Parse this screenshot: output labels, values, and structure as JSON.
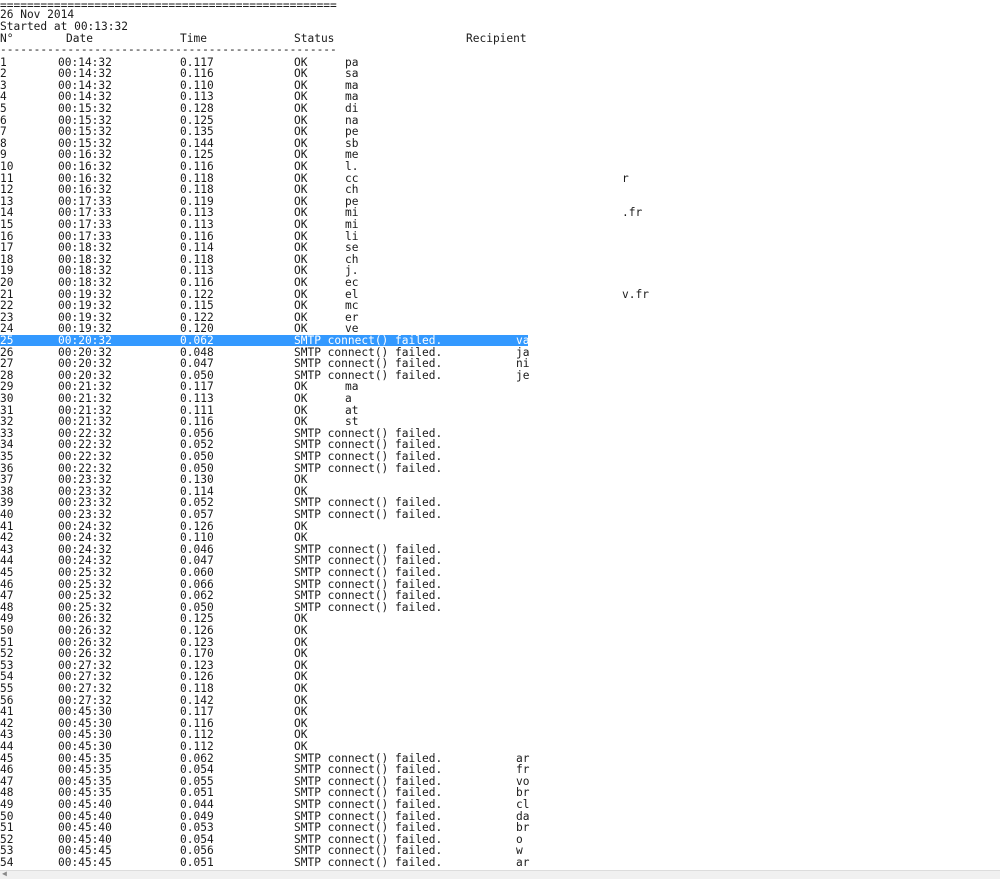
{
  "header": {
    "separator_top": "==================================================",
    "date_line": "26 Nov 2014",
    "started_line": "Started at 00:13:32",
    "separator_mid": "--------------------------------------------------"
  },
  "columns": {
    "num": "N°",
    "date": "Date",
    "time": "Time",
    "status": "Status",
    "recipient": "Recipient"
  },
  "rows": [
    {
      "n": "1",
      "d": "00:14:32",
      "t": "0.117",
      "s": "OK",
      "r": "pa"
    },
    {
      "n": "2",
      "d": "00:14:32",
      "t": "0.116",
      "s": "OK",
      "r": "sa"
    },
    {
      "n": "3",
      "d": "00:14:32",
      "t": "0.110",
      "s": "OK",
      "r": "ma"
    },
    {
      "n": "4",
      "d": "00:14:32",
      "t": "0.113",
      "s": "OK",
      "r": "ma"
    },
    {
      "n": "5",
      "d": "00:15:32",
      "t": "0.128",
      "s": "OK",
      "r": "di"
    },
    {
      "n": "6",
      "d": "00:15:32",
      "t": "0.125",
      "s": "OK",
      "r": "na"
    },
    {
      "n": "7",
      "d": "00:15:32",
      "t": "0.135",
      "s": "OK",
      "r": "pe"
    },
    {
      "n": "8",
      "d": "00:15:32",
      "t": "0.144",
      "s": "OK",
      "r": "sb"
    },
    {
      "n": "9",
      "d": "00:16:32",
      "t": "0.125",
      "s": "OK",
      "r": "me"
    },
    {
      "n": "10",
      "d": "00:16:32",
      "t": "0.116",
      "s": "OK",
      "r": "l."
    },
    {
      "n": "11",
      "d": "00:16:32",
      "t": "0.118",
      "s": "OK",
      "r": "cc"
    },
    {
      "n": "12",
      "d": "00:16:32",
      "t": "0.118",
      "s": "OK",
      "r": "ch"
    },
    {
      "n": "13",
      "d": "00:17:33",
      "t": "0.119",
      "s": "OK",
      "r": "pe"
    },
    {
      "n": "14",
      "d": "00:17:33",
      "t": "0.113",
      "s": "OK",
      "r": "mi"
    },
    {
      "n": "15",
      "d": "00:17:33",
      "t": "0.113",
      "s": "OK",
      "r": "mi"
    },
    {
      "n": "16",
      "d": "00:17:33",
      "t": "0.116",
      "s": "OK",
      "r": "li"
    },
    {
      "n": "17",
      "d": "00:18:32",
      "t": "0.114",
      "s": "OK",
      "r": "se"
    },
    {
      "n": "18",
      "d": "00:18:32",
      "t": "0.118",
      "s": "OK",
      "r": "ch"
    },
    {
      "n": "19",
      "d": "00:18:32",
      "t": "0.113",
      "s": "OK",
      "r": "j."
    },
    {
      "n": "20",
      "d": "00:18:32",
      "t": "0.116",
      "s": "OK",
      "r": "ec"
    },
    {
      "n": "21",
      "d": "00:19:32",
      "t": "0.122",
      "s": "OK",
      "r": "el"
    },
    {
      "n": "22",
      "d": "00:19:32",
      "t": "0.115",
      "s": "OK",
      "r": "mc"
    },
    {
      "n": "23",
      "d": "00:19:32",
      "t": "0.122",
      "s": "OK",
      "r": "er"
    },
    {
      "n": "24",
      "d": "00:19:32",
      "t": "0.120",
      "s": "OK",
      "r": "ve"
    },
    {
      "n": "25",
      "d": "00:20:32",
      "t": "0.062",
      "s": "SMTP connect() failed.",
      "r": "va",
      "selected": true
    },
    {
      "n": "26",
      "d": "00:20:32",
      "t": "0.048",
      "s": "SMTP connect() failed.",
      "r": "ja"
    },
    {
      "n": "27",
      "d": "00:20:32",
      "t": "0.047",
      "s": "SMTP connect() failed.",
      "r": "ni"
    },
    {
      "n": "28",
      "d": "00:20:32",
      "t": "0.050",
      "s": "SMTP connect() failed.",
      "r": "je"
    },
    {
      "n": "29",
      "d": "00:21:32",
      "t": "0.117",
      "s": "OK",
      "r": "ma"
    },
    {
      "n": "30",
      "d": "00:21:32",
      "t": "0.113",
      "s": "OK",
      "r": "a"
    },
    {
      "n": "31",
      "d": "00:21:32",
      "t": "0.111",
      "s": "OK",
      "r": "at"
    },
    {
      "n": "32",
      "d": "00:21:32",
      "t": "0.116",
      "s": "OK",
      "r": "st"
    },
    {
      "n": "33",
      "d": "00:22:32",
      "t": "0.056",
      "s": "SMTP connect() failed.",
      "r": ""
    },
    {
      "n": "34",
      "d": "00:22:32",
      "t": "0.052",
      "s": "SMTP connect() failed.",
      "r": ""
    },
    {
      "n": "35",
      "d": "00:22:32",
      "t": "0.050",
      "s": "SMTP connect() failed.",
      "r": ""
    },
    {
      "n": "36",
      "d": "00:22:32",
      "t": "0.050",
      "s": "SMTP connect() failed.",
      "r": ""
    },
    {
      "n": "37",
      "d": "00:23:32",
      "t": "0.130",
      "s": "OK",
      "r": ""
    },
    {
      "n": "38",
      "d": "00:23:32",
      "t": "0.114",
      "s": "OK",
      "r": ""
    },
    {
      "n": "39",
      "d": "00:23:32",
      "t": "0.052",
      "s": "SMTP connect() failed.",
      "r": ""
    },
    {
      "n": "40",
      "d": "00:23:32",
      "t": "0.057",
      "s": "SMTP connect() failed.",
      "r": ""
    },
    {
      "n": "41",
      "d": "00:24:32",
      "t": "0.126",
      "s": "OK",
      "r": ""
    },
    {
      "n": "42",
      "d": "00:24:32",
      "t": "0.110",
      "s": "OK",
      "r": ""
    },
    {
      "n": "43",
      "d": "00:24:32",
      "t": "0.046",
      "s": "SMTP connect() failed.",
      "r": ""
    },
    {
      "n": "44",
      "d": "00:24:32",
      "t": "0.047",
      "s": "SMTP connect() failed.",
      "r": ""
    },
    {
      "n": "45",
      "d": "00:25:32",
      "t": "0.060",
      "s": "SMTP connect() failed.",
      "r": ""
    },
    {
      "n": "46",
      "d": "00:25:32",
      "t": "0.066",
      "s": "SMTP connect() failed.",
      "r": ""
    },
    {
      "n": "47",
      "d": "00:25:32",
      "t": "0.062",
      "s": "SMTP connect() failed.",
      "r": ""
    },
    {
      "n": "48",
      "d": "00:25:32",
      "t": "0.050",
      "s": "SMTP connect() failed.",
      "r": ""
    },
    {
      "n": "49",
      "d": "00:26:32",
      "t": "0.125",
      "s": "OK",
      "r": ""
    },
    {
      "n": "50",
      "d": "00:26:32",
      "t": "0.126",
      "s": "OK",
      "r": ""
    },
    {
      "n": "51",
      "d": "00:26:32",
      "t": "0.123",
      "s": "OK",
      "r": ""
    },
    {
      "n": "52",
      "d": "00:26:32",
      "t": "0.170",
      "s": "OK",
      "r": ""
    },
    {
      "n": "53",
      "d": "00:27:32",
      "t": "0.123",
      "s": "OK",
      "r": ""
    },
    {
      "n": "54",
      "d": "00:27:32",
      "t": "0.126",
      "s": "OK",
      "r": ""
    },
    {
      "n": "55",
      "d": "00:27:32",
      "t": "0.118",
      "s": "OK",
      "r": ""
    },
    {
      "n": "56",
      "d": "00:27:32",
      "t": "0.142",
      "s": "OK",
      "r": ""
    },
    {
      "n": "41",
      "d": "00:45:30",
      "t": "0.117",
      "s": "OK",
      "r": ""
    },
    {
      "n": "42",
      "d": "00:45:30",
      "t": "0.116",
      "s": "OK",
      "r": ""
    },
    {
      "n": "43",
      "d": "00:45:30",
      "t": "0.112",
      "s": "OK",
      "r": ""
    },
    {
      "n": "44",
      "d": "00:45:30",
      "t": "0.112",
      "s": "OK",
      "r": ""
    },
    {
      "n": "45",
      "d": "00:45:35",
      "t": "0.062",
      "s": "SMTP connect() failed.",
      "r": "ar"
    },
    {
      "n": "46",
      "d": "00:45:35",
      "t": "0.054",
      "s": "SMTP connect() failed.",
      "r": "fr"
    },
    {
      "n": "47",
      "d": "00:45:35",
      "t": "0.055",
      "s": "SMTP connect() failed.",
      "r": "vo"
    },
    {
      "n": "48",
      "d": "00:45:35",
      "t": "0.051",
      "s": "SMTP connect() failed.",
      "r": "br"
    },
    {
      "n": "49",
      "d": "00:45:40",
      "t": "0.044",
      "s": "SMTP connect() failed.",
      "r": "cl"
    },
    {
      "n": "50",
      "d": "00:45:40",
      "t": "0.049",
      "s": "SMTP connect() failed.",
      "r": "da"
    },
    {
      "n": "51",
      "d": "00:45:40",
      "t": "0.053",
      "s": "SMTP connect() failed.",
      "r": "br"
    },
    {
      "n": "52",
      "d": "00:45:40",
      "t": "0.054",
      "s": "SMTP connect() failed.",
      "r": "o"
    },
    {
      "n": "53",
      "d": "00:45:45",
      "t": "0.056",
      "s": "SMTP connect() failed.",
      "r": "w"
    },
    {
      "n": "54",
      "d": "00:45:45",
      "t": "0.051",
      "s": "SMTP connect() failed.",
      "r": "ar"
    }
  ],
  "fragments": [
    {
      "text": "r",
      "row": 10
    },
    {
      "text": ".fr",
      "row": 13
    },
    {
      "text": "v.fr",
      "row": 20
    }
  ],
  "colors": {
    "selection": "#3399ff",
    "selection_text": "#ffffff",
    "text": "#1a1a1a",
    "background": "#ffffff"
  }
}
